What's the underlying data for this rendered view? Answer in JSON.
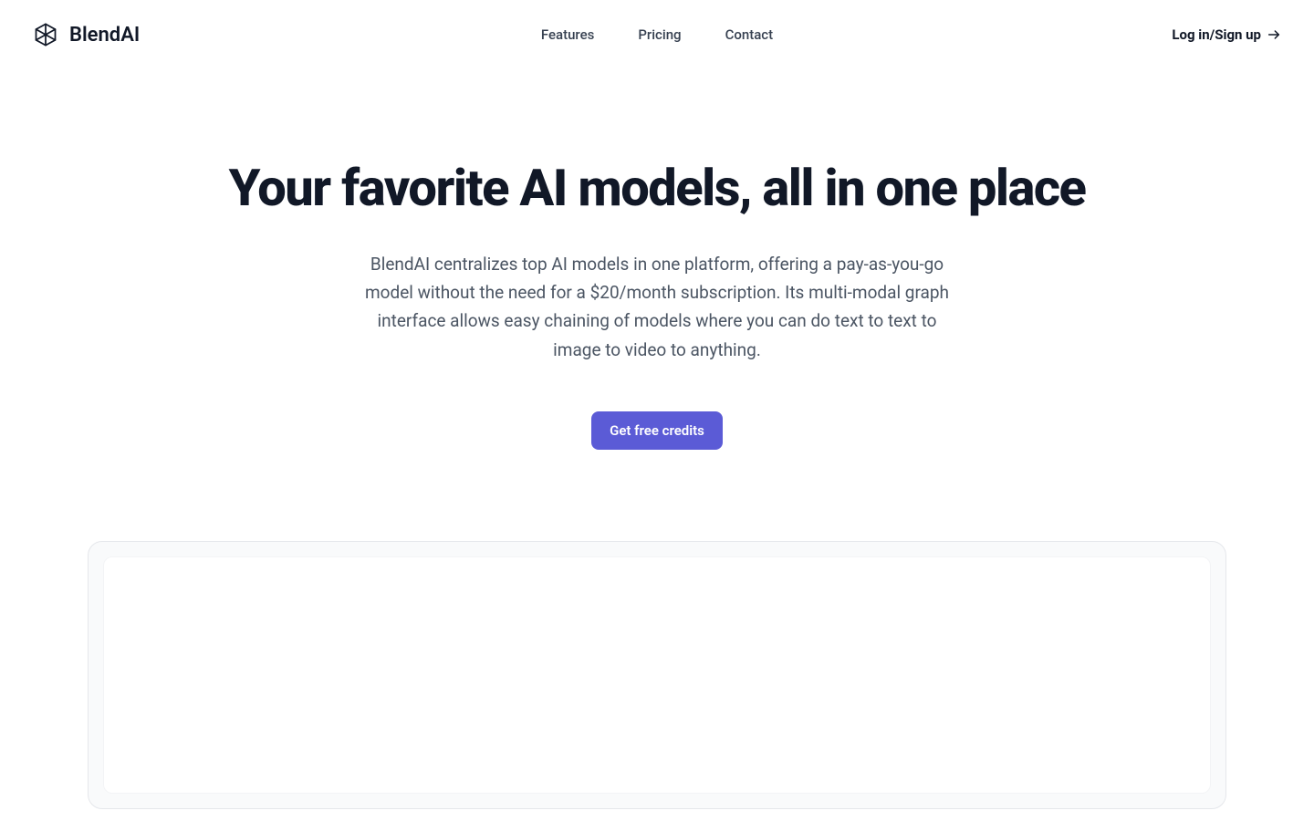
{
  "header": {
    "brand": "BlendAI",
    "nav": {
      "features": "Features",
      "pricing": "Pricing",
      "contact": "Contact"
    },
    "login": "Log in/Sign up"
  },
  "hero": {
    "title": "Your favorite AI models, all in one place",
    "description": "BlendAI centralizes top AI models in one platform, offering a pay-as-you-go model without the need for a $20/month subscription. Its multi-modal graph interface allows easy chaining of models where you can do text to text to image to video to anything.",
    "cta": "Get free credits"
  }
}
